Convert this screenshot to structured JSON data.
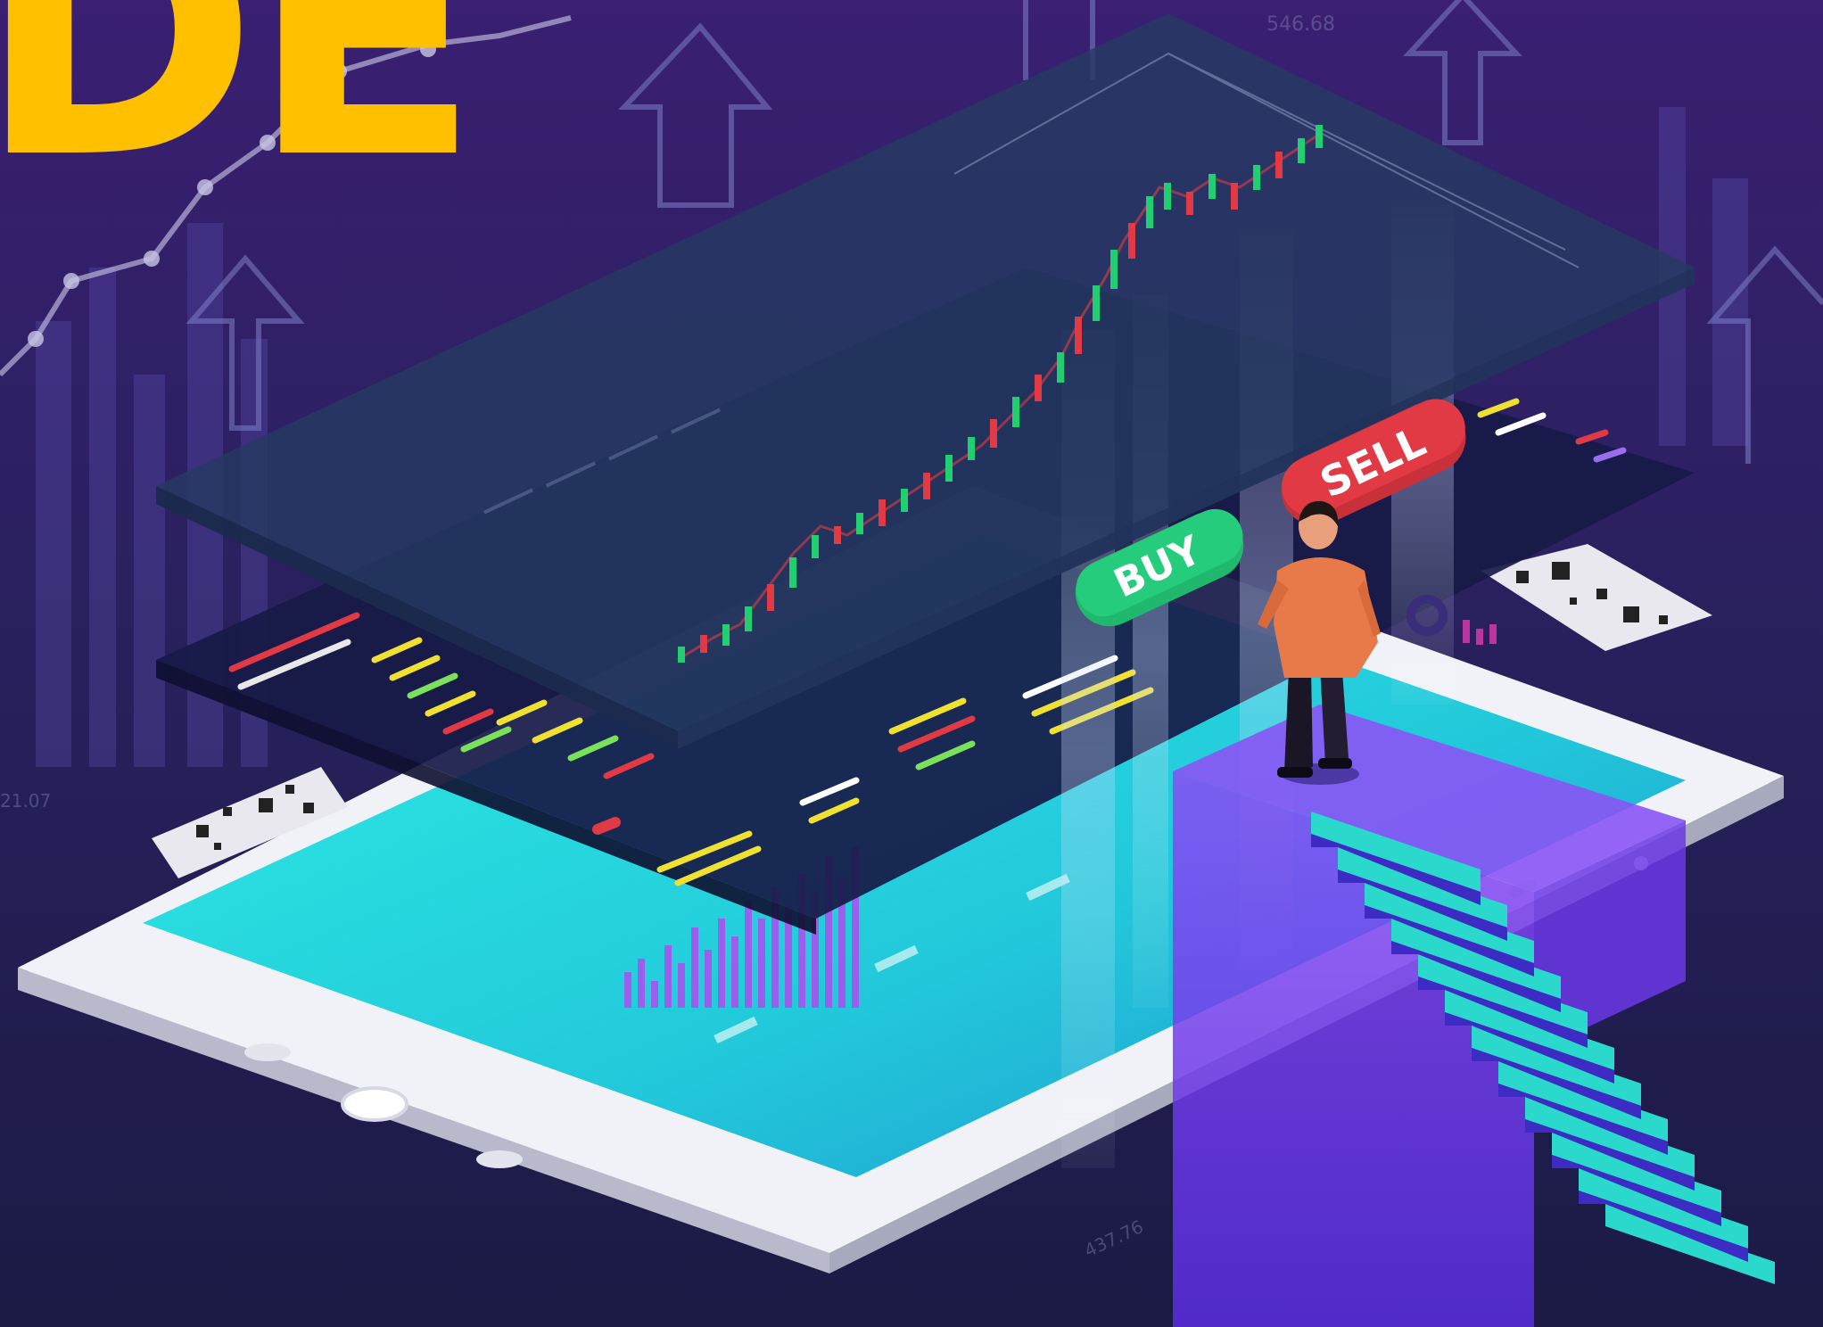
{
  "headline": "DE",
  "buttons": {
    "buy_label": "BUY",
    "sell_label": "SELL"
  },
  "background_labels": {
    "top_value": "546.68",
    "left_value": "21.07",
    "axis_value": "437.76"
  },
  "colors": {
    "background": "#1e1a48",
    "headline": "#ffc000",
    "buy": "#1fb86c",
    "sell": "#e23a44",
    "screen": "#27e0e0",
    "pillar": "#7a3cf0"
  },
  "icons": [
    "trend-arrow-icon",
    "candlestick-chart-icon",
    "tablet-icon",
    "person-icon",
    "staircase-icon"
  ]
}
